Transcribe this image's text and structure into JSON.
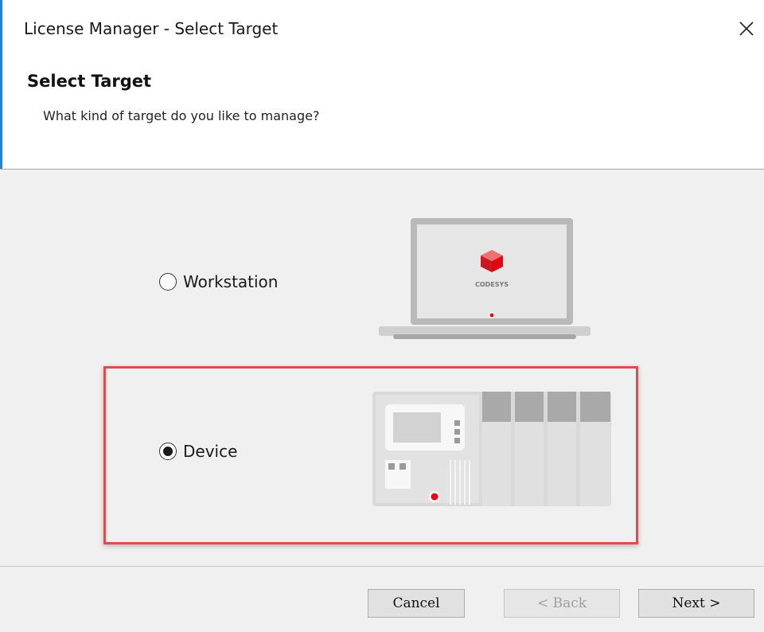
{
  "window": {
    "title": "License Manager - Select Target"
  },
  "header": {
    "title": "Select Target",
    "subtitle": "What kind of target do you like to manage?"
  },
  "options": {
    "workstation": {
      "label": "Workstation",
      "selected": false
    },
    "device": {
      "label": "Device",
      "selected": true
    }
  },
  "illustrations": {
    "laptop_brand": "CODESYS"
  },
  "buttons": {
    "cancel": "Cancel",
    "back": "< Back",
    "next": "Next >"
  },
  "colors": {
    "highlight": "#e8474c",
    "accent_red": "#e30613",
    "window_accent": "#2f7fcf"
  }
}
